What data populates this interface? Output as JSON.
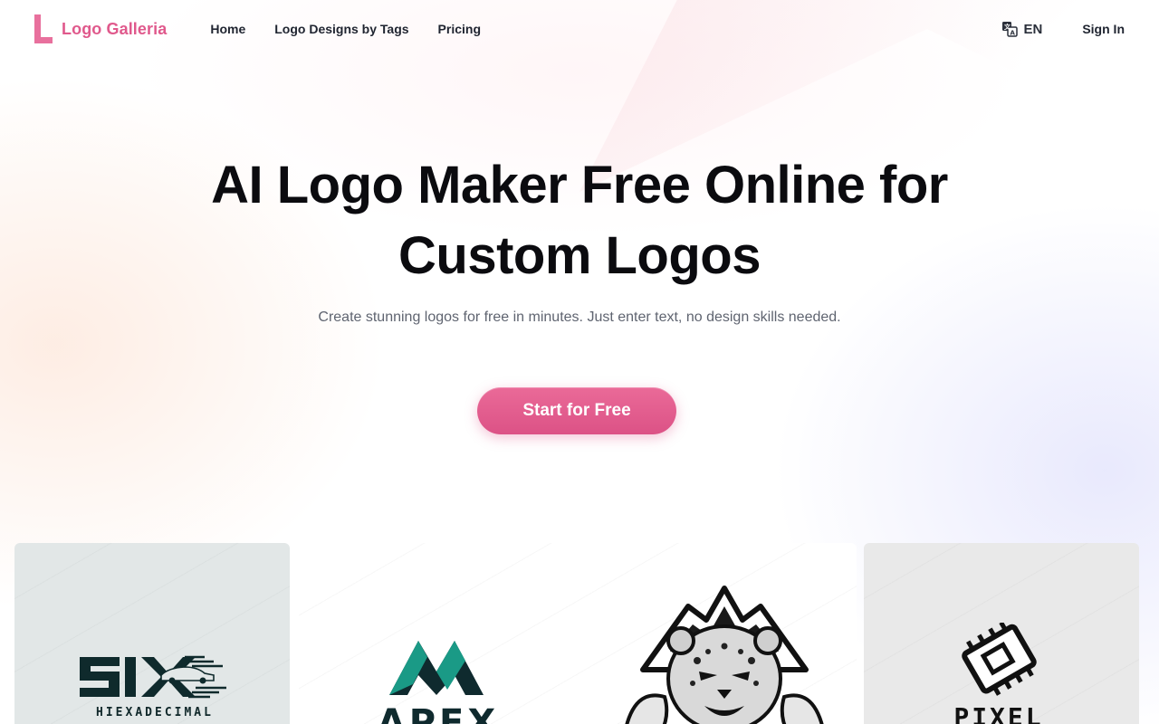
{
  "nav": {
    "brand": "Logo Galleria",
    "links": [
      {
        "label": "Home"
      },
      {
        "label": "Logo Designs by Tags"
      },
      {
        "label": "Pricing"
      }
    ],
    "language": "EN",
    "sign_in": "Sign In"
  },
  "hero": {
    "title_line1": "AI Logo Maker Free Online for",
    "title_line2": "Custom Logos",
    "subtitle": "Create stunning logos for free in minutes. Just enter text, no design skills needed.",
    "cta": "Start for Free"
  },
  "gallery": [
    {
      "text": "SIX",
      "subtext": "HIEXADECIMAL",
      "bg": "#e2e7e7"
    },
    {
      "text": "APEX",
      "bg": "#ffffff"
    },
    {
      "text": "",
      "bg": "#ffffff"
    },
    {
      "text": "PIXEL",
      "bg": "#e9e9e9"
    }
  ],
  "colors": {
    "brand": "#e0598c",
    "cta": "#e35f91",
    "apex_teal": "#1a9a86"
  },
  "icons": {
    "translate": "translate-icon"
  }
}
